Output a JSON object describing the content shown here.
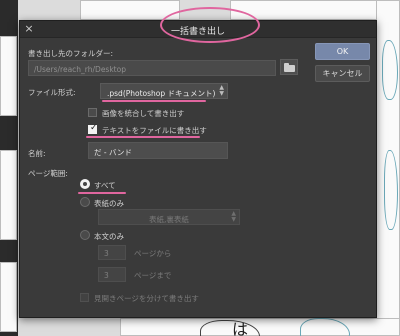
{
  "dialog": {
    "title": "一括書き出し",
    "close_icon": "×"
  },
  "output_folder": {
    "label": "書き出し先のフォルダー:",
    "value": "/Users/reach_rh/Desktop",
    "browse_icon": "folder-icon"
  },
  "buttons": {
    "ok": "OK",
    "cancel": "キャンセル"
  },
  "file_format": {
    "label": "ファイル形式:",
    "selected": ".psd(Photoshop ドキュメント)"
  },
  "options": {
    "merge_images": {
      "label": "画像を統合して書き出す",
      "checked": false
    },
    "export_text": {
      "label": "テキストをファイルに書き出す",
      "checked": true
    }
  },
  "name": {
    "label": "名前:",
    "value": "だ - バンド"
  },
  "page_range": {
    "label": "ページ範囲:",
    "all": "すべて",
    "cover_only": "表紙のみ",
    "cover_select": "表紙,裏表紙",
    "body_only": "本文のみ",
    "from_value": "3",
    "from_label": "ページから",
    "to_value": "3",
    "to_label": "ページまで",
    "spread_label": "見開きページを分けて書き出す",
    "selected": "all"
  },
  "colors": {
    "dialog_bg": "#3a3a3a",
    "ok_button": "#7788aa",
    "highlight": "#e0669f"
  }
}
